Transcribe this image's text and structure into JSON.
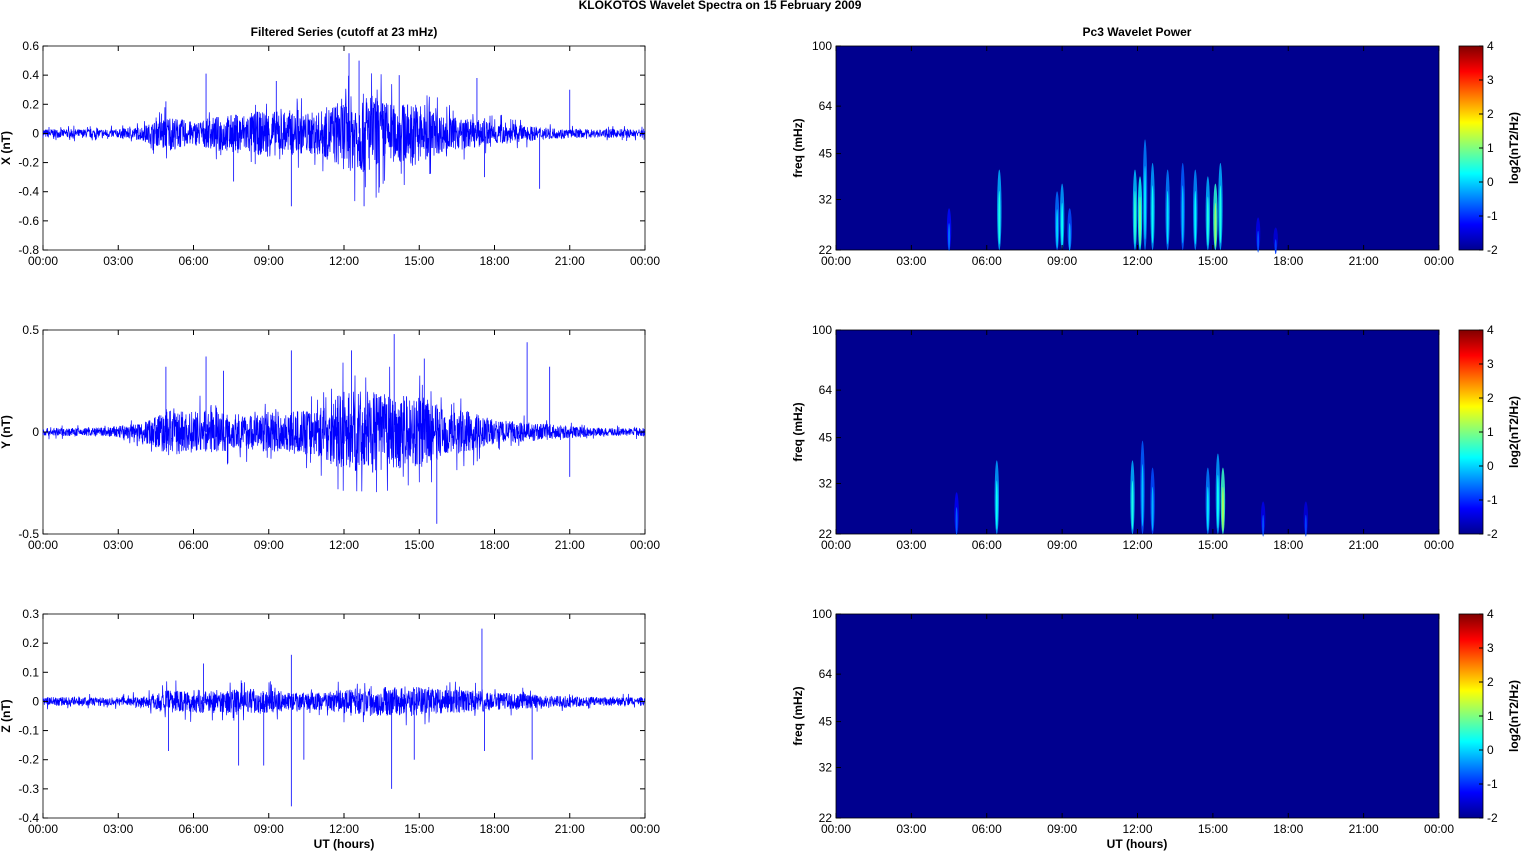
{
  "title": "KLOKOTOS Wavelet Spectra on 15 February  2009",
  "left_title": "Filtered Series (cutoff at 23 mHz)",
  "right_title": "Pc3 Wavelet Power",
  "xlabel": "UT (hours)",
  "colors": {
    "series": "#0000ff",
    "background": "#00008f"
  },
  "chart_data": [
    {
      "type": "line",
      "component": "X",
      "ylabel": "X (nT)",
      "ylim": [
        -0.8,
        0.6
      ],
      "yticks": [
        "0.6",
        "0.4",
        "0.2",
        "0",
        "-0.2",
        "-0.4",
        "-0.6",
        "-0.8"
      ],
      "ytick_values": [
        0.6,
        0.4,
        0.2,
        0,
        -0.2,
        -0.4,
        -0.6,
        -0.8
      ],
      "xticks": [
        "00:00",
        "03:00",
        "06:00",
        "09:00",
        "12:00",
        "15:00",
        "18:00",
        "21:00",
        "00:00"
      ],
      "envelope_hourly": [
        0.03,
        0.03,
        0.03,
        0.03,
        0.05,
        0.12,
        0.08,
        0.12,
        0.14,
        0.16,
        0.14,
        0.15,
        0.25,
        0.28,
        0.2,
        0.22,
        0.12,
        0.1,
        0.08,
        0.06,
        0.04,
        0.03,
        0.03,
        0.03
      ],
      "spikes": [
        [
          4.9,
          0.22
        ],
        [
          6.5,
          0.41
        ],
        [
          7.6,
          -0.33
        ],
        [
          9.9,
          -0.5
        ],
        [
          9.3,
          0.36
        ],
        [
          12.2,
          0.55
        ],
        [
          12.6,
          0.5
        ],
        [
          12.8,
          -0.5
        ],
        [
          14.2,
          0.4
        ],
        [
          17.3,
          0.38
        ],
        [
          17.6,
          -0.3
        ],
        [
          19.8,
          -0.38
        ],
        [
          21.0,
          0.3
        ]
      ]
    },
    {
      "type": "line",
      "component": "Y",
      "ylabel": "Y (nT)",
      "ylim": [
        -0.5,
        0.5
      ],
      "yticks": [
        "0.5",
        "0",
        "-0.5"
      ],
      "ytick_values": [
        0.5,
        0,
        -0.5
      ],
      "xticks": [
        "00:00",
        "03:00",
        "06:00",
        "09:00",
        "12:00",
        "15:00",
        "18:00",
        "21:00",
        "00:00"
      ],
      "envelope_hourly": [
        0.02,
        0.02,
        0.02,
        0.03,
        0.05,
        0.12,
        0.1,
        0.1,
        0.08,
        0.1,
        0.1,
        0.12,
        0.2,
        0.2,
        0.18,
        0.18,
        0.12,
        0.1,
        0.06,
        0.05,
        0.04,
        0.03,
        0.02,
        0.02
      ],
      "spikes": [
        [
          4.9,
          0.32
        ],
        [
          6.5,
          0.37
        ],
        [
          7.2,
          0.3
        ],
        [
          9.9,
          0.4
        ],
        [
          12.3,
          0.4
        ],
        [
          14.0,
          0.48
        ],
        [
          15.7,
          -0.45
        ],
        [
          15.2,
          0.36
        ],
        [
          19.3,
          0.44
        ],
        [
          20.2,
          0.32
        ],
        [
          21.0,
          -0.22
        ]
      ]
    },
    {
      "type": "line",
      "component": "Z",
      "ylabel": "Z (nT)",
      "ylim": [
        -0.4,
        0.3
      ],
      "yticks": [
        "0.3",
        "0.2",
        "0.1",
        "0",
        "-0.1",
        "-0.2",
        "-0.3",
        "-0.4"
      ],
      "ytick_values": [
        0.3,
        0.2,
        0.1,
        0,
        -0.1,
        -0.2,
        -0.3,
        -0.4
      ],
      "xticks": [
        "00:00",
        "03:00",
        "06:00",
        "09:00",
        "12:00",
        "15:00",
        "18:00",
        "21:00",
        "00:00"
      ],
      "envelope_hourly": [
        0.015,
        0.015,
        0.015,
        0.015,
        0.02,
        0.04,
        0.04,
        0.04,
        0.04,
        0.04,
        0.03,
        0.03,
        0.04,
        0.05,
        0.05,
        0.05,
        0.04,
        0.04,
        0.03,
        0.03,
        0.02,
        0.02,
        0.015,
        0.015
      ],
      "spikes": [
        [
          5.0,
          -0.17
        ],
        [
          6.4,
          0.13
        ],
        [
          7.8,
          -0.22
        ],
        [
          8.8,
          -0.22
        ],
        [
          9.9,
          -0.36
        ],
        [
          9.9,
          0.16
        ],
        [
          10.4,
          -0.2
        ],
        [
          13.9,
          -0.3
        ],
        [
          14.8,
          -0.2
        ],
        [
          17.5,
          0.25
        ],
        [
          17.6,
          -0.17
        ],
        [
          19.5,
          -0.2
        ]
      ]
    },
    {
      "type": "heatmap",
      "component": "X",
      "ylabel": "freq (mHz)",
      "yticks": [
        "100",
        "64",
        "45",
        "32",
        "22"
      ],
      "ytick_values": [
        100,
        64,
        45,
        32,
        22
      ],
      "clabel": "log2(nT2/Hz)",
      "clim": [
        -2,
        4
      ],
      "cticks": [
        "4",
        "3",
        "2",
        "1",
        "0",
        "-1",
        "-2"
      ],
      "xticks": [
        "00:00",
        "03:00",
        "06:00",
        "09:00",
        "12:00",
        "15:00",
        "18:00",
        "21:00",
        "00:00"
      ],
      "bursts": [
        [
          4.5,
          30,
          -1.2
        ],
        [
          6.5,
          40,
          -0.2
        ],
        [
          8.8,
          34,
          -0.6
        ],
        [
          9.0,
          36,
          -0.3
        ],
        [
          9.3,
          30,
          -0.8
        ],
        [
          11.9,
          40,
          -0.1
        ],
        [
          12.1,
          38,
          0.3
        ],
        [
          12.3,
          50,
          -0.5
        ],
        [
          12.6,
          42,
          -0.3
        ],
        [
          13.2,
          40,
          -0.5
        ],
        [
          13.8,
          42,
          -0.7
        ],
        [
          14.3,
          40,
          -0.4
        ],
        [
          14.8,
          38,
          -0.2
        ],
        [
          15.1,
          36,
          0.5
        ],
        [
          15.3,
          42,
          -0.2
        ],
        [
          16.8,
          28,
          -1.4
        ],
        [
          17.5,
          26,
          -1.5
        ]
      ]
    },
    {
      "type": "heatmap",
      "component": "Y",
      "ylabel": "freq (mHz)",
      "yticks": [
        "100",
        "64",
        "45",
        "32",
        "22"
      ],
      "ytick_values": [
        100,
        64,
        45,
        32,
        22
      ],
      "clabel": "log2(nT2/Hz)",
      "clim": [
        -2,
        4
      ],
      "cticks": [
        "4",
        "3",
        "2",
        "1",
        "0",
        "-1",
        "-2"
      ],
      "xticks": [
        "00:00",
        "03:00",
        "06:00",
        "09:00",
        "12:00",
        "15:00",
        "18:00",
        "21:00",
        "00:00"
      ],
      "bursts": [
        [
          4.8,
          30,
          -1.3
        ],
        [
          6.4,
          38,
          -0.3
        ],
        [
          11.8,
          38,
          -0.2
        ],
        [
          12.2,
          44,
          -0.7
        ],
        [
          12.6,
          36,
          -0.8
        ],
        [
          14.8,
          36,
          -0.5
        ],
        [
          15.2,
          40,
          -0.3
        ],
        [
          15.4,
          36,
          0.6
        ],
        [
          17.0,
          28,
          -1.4
        ],
        [
          18.7,
          28,
          -1.5
        ]
      ]
    },
    {
      "type": "heatmap",
      "component": "Z",
      "ylabel": "freq (mHz)",
      "yticks": [
        "100",
        "64",
        "45",
        "32",
        "22"
      ],
      "ytick_values": [
        100,
        64,
        45,
        32,
        22
      ],
      "clabel": "log2(nT2/Hz)",
      "clim": [
        -2,
        4
      ],
      "cticks": [
        "4",
        "3",
        "2",
        "1",
        "0",
        "-1",
        "-2"
      ],
      "xticks": [
        "00:00",
        "03:00",
        "06:00",
        "09:00",
        "12:00",
        "15:00",
        "18:00",
        "21:00",
        "00:00"
      ],
      "bursts": []
    }
  ]
}
